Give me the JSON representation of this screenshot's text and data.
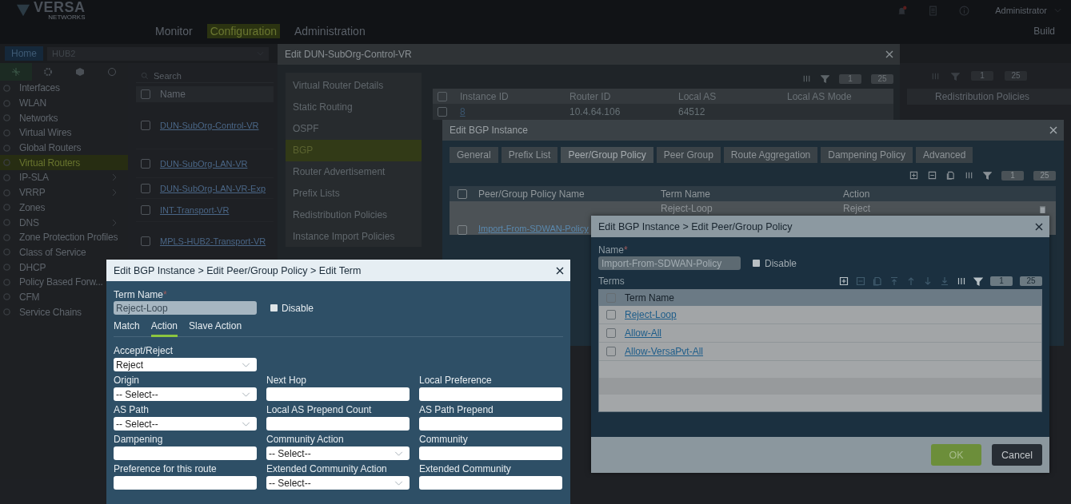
{
  "top_bar": {
    "logo": "VERSA",
    "logo_sub": "NETWORKS",
    "nav": [
      {
        "label": "Monitor",
        "selected": false
      },
      {
        "label": "Configuration",
        "selected": true
      },
      {
        "label": "Administration",
        "selected": false
      }
    ],
    "user": "Administrator",
    "build": "Build"
  },
  "sub_bar": {
    "home": "Home",
    "appliance": "HUB2"
  },
  "sidebar": {
    "items": [
      {
        "label": "Interfaces",
        "selected": false,
        "expandable": false
      },
      {
        "label": "WLAN",
        "selected": false,
        "expandable": false
      },
      {
        "label": "Networks",
        "selected": false,
        "expandable": false
      },
      {
        "label": "Virtual Wires",
        "selected": false,
        "expandable": false
      },
      {
        "label": "Global Routers",
        "selected": false,
        "expandable": false
      },
      {
        "label": "Virtual Routers",
        "selected": true,
        "expandable": false
      },
      {
        "label": "IP-SLA",
        "selected": false,
        "expandable": true
      },
      {
        "label": "VRRP",
        "selected": false,
        "expandable": true
      },
      {
        "label": "Zones",
        "selected": false,
        "expandable": false
      },
      {
        "label": "DNS",
        "selected": false,
        "expandable": true
      },
      {
        "label": "Zone Protection Profiles",
        "selected": false,
        "expandable": false
      },
      {
        "label": "Class of Service",
        "selected": false,
        "expandable": false
      },
      {
        "label": "DHCP",
        "selected": false,
        "expandable": false
      },
      {
        "label": "Policy Based Forw...",
        "selected": false,
        "expandable": false
      },
      {
        "label": "CFM",
        "selected": false,
        "expandable": false
      },
      {
        "label": "Service Chains",
        "selected": false,
        "expandable": false
      }
    ]
  },
  "router_list": {
    "search_placeholder": "Search",
    "column": "Name",
    "all_checked": false,
    "rows": [
      {
        "name": "DUN-SubOrg-Control-VR",
        "checked": false
      },
      {
        "name": "DUN-SubOrg-LAN-VR",
        "checked": false
      },
      {
        "name": "DUN-SubOrg-LAN-VR-Exp",
        "checked": false
      },
      {
        "name": "INT-Transport-VR",
        "checked": false
      },
      {
        "name": "MPLS-HUB2-Transport-VR",
        "checked": false
      }
    ]
  },
  "right_panel": {
    "page": "1",
    "page_size": "25",
    "column": "Redistribution Policies"
  },
  "vr_dialog": {
    "title": "Edit DUN-SubOrg-Control-VR",
    "menu": [
      {
        "label": "Virtual Router Details",
        "selected": false
      },
      {
        "label": "Static Routing",
        "selected": false
      },
      {
        "label": "OSPF",
        "selected": false
      },
      {
        "label": "BGP",
        "selected": true
      },
      {
        "label": "Router Advertisement",
        "selected": false
      },
      {
        "label": "Prefix Lists",
        "selected": false
      },
      {
        "label": "Redistribution Policies",
        "selected": false
      },
      {
        "label": "Instance Import Policies",
        "selected": false
      }
    ],
    "page": "1",
    "page_size": "25",
    "columns": [
      "Instance ID",
      "Router ID",
      "Local AS",
      "Local AS Mode"
    ],
    "all_checked": false,
    "rows": [
      {
        "instance_id": "8",
        "router_id": "10.4.64.106",
        "local_as": "64512",
        "checked": false
      }
    ]
  },
  "bgp_dialog": {
    "title": "Edit BGP Instance",
    "tabs": [
      {
        "label": "General",
        "selected": false
      },
      {
        "label": "Prefix List",
        "selected": false
      },
      {
        "label": "Peer/Group Policy",
        "selected": true
      },
      {
        "label": "Peer Group",
        "selected": false
      },
      {
        "label": "Route Aggregation",
        "selected": false
      },
      {
        "label": "Dampening Policy",
        "selected": false
      },
      {
        "label": "Advanced",
        "selected": false
      }
    ],
    "page": "1",
    "page_size": "25",
    "columns": [
      "Peer/Group Policy Name",
      "Term Name",
      "Action"
    ],
    "all_checked": false,
    "rows": [
      {
        "policy": "Import-From-SDWAN-Policy",
        "term": "Reject-Loop",
        "action": "Reject",
        "checked": false
      }
    ]
  },
  "policy_dialog": {
    "title": "Edit BGP Instance > Edit Peer/Group Policy",
    "name_label": "Name",
    "required_mark": "*",
    "name_value": "Import-From-SDWAN-Policy",
    "disable": {
      "label": "Disable",
      "checked": false
    },
    "terms_label": "Terms",
    "page": "1",
    "page_size": "25",
    "column": "Term Name",
    "all_checked": false,
    "terms": [
      {
        "name": "Reject-Loop",
        "checked": false
      },
      {
        "name": "Allow-All",
        "checked": false
      },
      {
        "name": "Allow-VersaPvt-All",
        "checked": false
      }
    ],
    "ok": "OK",
    "cancel": "Cancel"
  },
  "term_dialog": {
    "title": "Edit BGP Instance > Edit Peer/Group Policy > Edit Term",
    "term_name_label": "Term Name",
    "required_mark": "*",
    "term_name": "Reject-Loop",
    "disable": {
      "label": "Disable",
      "checked": false
    },
    "tabs": [
      {
        "label": "Match",
        "selected": false
      },
      {
        "label": "Action",
        "selected": true
      },
      {
        "label": "Slave Action",
        "selected": false
      }
    ],
    "accept_reject": {
      "label": "Accept/Reject",
      "value": "Reject"
    },
    "fields": [
      {
        "label": "Origin",
        "kind": "select",
        "value": "-- Select--"
      },
      {
        "label": "Next Hop",
        "kind": "text"
      },
      {
        "label": "Local Preference",
        "kind": "text"
      },
      {
        "label": "AS Path",
        "kind": "select",
        "value": "-- Select--"
      },
      {
        "label": "Local AS Prepend Count",
        "kind": "text"
      },
      {
        "label": "AS Path Prepend",
        "kind": "text"
      },
      {
        "label": "Dampening",
        "kind": "text"
      },
      {
        "label": "Community Action",
        "kind": "select",
        "value": "-- Select--"
      },
      {
        "label": "Community",
        "kind": "text"
      },
      {
        "label": "Preference for this route",
        "kind": "text"
      },
      {
        "label": "Extended Community Action",
        "kind": "select",
        "value": "-- Select--"
      },
      {
        "label": "Extended Community",
        "kind": "text"
      }
    ]
  }
}
